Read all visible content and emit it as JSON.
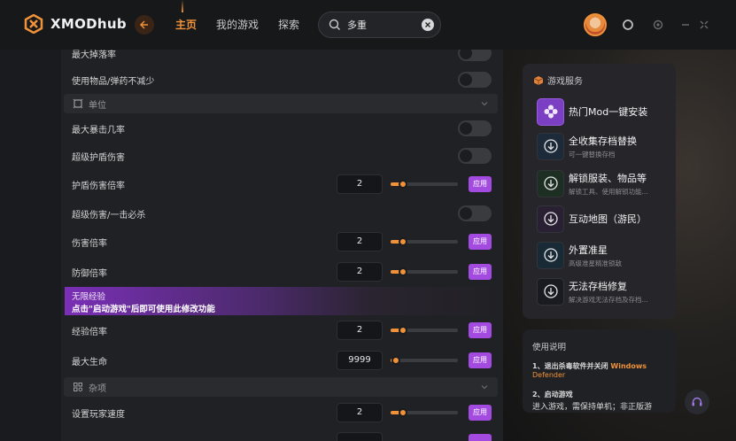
{
  "app": {
    "name": "XMODhub",
    "brand_color": "#f0923a",
    "accent_purple": "#a34be0"
  },
  "nav": {
    "tabs": [
      {
        "label": "主页",
        "active": true
      },
      {
        "label": "我的游戏",
        "active": false
      },
      {
        "label": "探索",
        "active": false
      }
    ]
  },
  "search": {
    "value": "多重"
  },
  "header_icons": [
    "avatar",
    "notification-icon",
    "settings-icon",
    "minimize-icon",
    "close-icon"
  ],
  "rows": [
    {
      "label": "最大掉落率",
      "control": "toggle"
    },
    {
      "label": "使用物品/弹药不减少",
      "control": "toggle"
    },
    {
      "label": "最大暴击几率",
      "control": "toggle"
    },
    {
      "label": "超级护盾伤害",
      "control": "toggle"
    },
    {
      "label": "护盾伤害倍率",
      "control": "slider",
      "value": "2",
      "apply": "应用"
    },
    {
      "label": "超级伤害/一击必杀",
      "control": "toggle"
    },
    {
      "label": "伤害倍率",
      "control": "slider",
      "value": "2",
      "apply": "应用"
    },
    {
      "label": "防御倍率",
      "control": "slider",
      "value": "2",
      "apply": "应用"
    },
    {
      "label": "经验倍率",
      "control": "slider",
      "value": "2",
      "apply": "应用"
    },
    {
      "label": "最大生命",
      "control": "slider",
      "value": "9999",
      "apply": "应用"
    },
    {
      "label": "设置玩家速度",
      "control": "slider",
      "value": "2",
      "apply": "应用"
    }
  ],
  "sections": {
    "unit": "单位",
    "misc": "杂项"
  },
  "banner": {
    "title": "无限经验",
    "subtitle": "点击\"启动游戏\"后即可使用此修改功能"
  },
  "services": {
    "header": "游戏服务",
    "items": [
      {
        "title": "热门Mod一键安装",
        "subtitle": "",
        "icon": "mod-flower-icon"
      },
      {
        "title": "全收集存档替换",
        "subtitle": "可一键替换存档",
        "icon": "download-icon"
      },
      {
        "title": "解锁服装、物品等",
        "subtitle": "解锁工具、使用解锁功能...",
        "icon": "download-icon"
      },
      {
        "title": "互动地图（游民）",
        "subtitle": "",
        "icon": "download-icon"
      },
      {
        "title": "外置准星",
        "subtitle": "高级准星精准锁敌",
        "icon": "download-icon"
      },
      {
        "title": "无法存档修复",
        "subtitle": "解决游戏无法存档及存档...",
        "icon": "download-icon"
      }
    ]
  },
  "instructions": {
    "title": "使用说明",
    "step1_prefix": "1、退出杀毒软件并关闭",
    "step1_accent": "Windows",
    "step1_accent2": "Defender",
    "step2_title": "2、启动游戏",
    "step2_text": "进入游戏，需保持单机；非正版游"
  }
}
